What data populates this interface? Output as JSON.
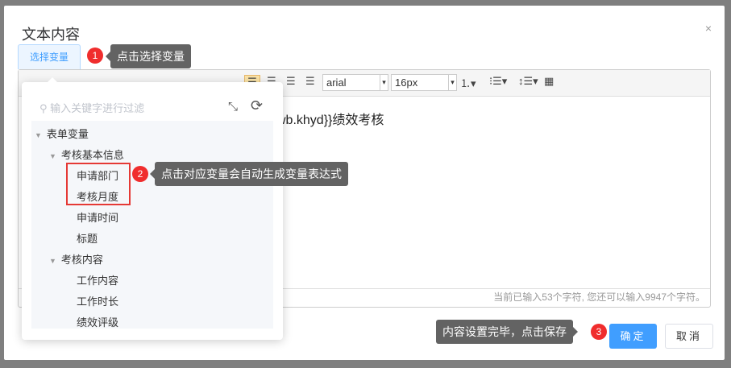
{
  "dialog": {
    "title": "文本内容",
    "close": "×"
  },
  "select_variable": "选择变量",
  "toolbar": {
    "font_family": "arial",
    "font_size": "16px"
  },
  "editor": {
    "content": "wb.khyd}}绩效考核",
    "counter": "当前已输入53个字符, 您还可以输入9947个字符。"
  },
  "panel": {
    "search_placeholder": "输入关键字进行过滤",
    "tree": {
      "root": "表单变量",
      "groups": [
        {
          "label": "考核基本信息",
          "items": [
            "申请部门",
            "考核月度",
            "申请时间",
            "标题"
          ]
        },
        {
          "label": "考核内容",
          "items": [
            "工作内容",
            "工作时长",
            "绩效评级"
          ]
        }
      ]
    }
  },
  "tips": [
    {
      "num": "1",
      "text": "点击选择变量"
    },
    {
      "num": "2",
      "text": "点击对应变量会自动生成变量表达式"
    },
    {
      "num": "3",
      "text": "内容设置完毕，点击保存"
    }
  ],
  "footer": {
    "ok": "确定",
    "cancel": "取消"
  },
  "colors": {
    "primary": "#409eff",
    "badge": "#f02d2d",
    "tip": "#636363"
  }
}
